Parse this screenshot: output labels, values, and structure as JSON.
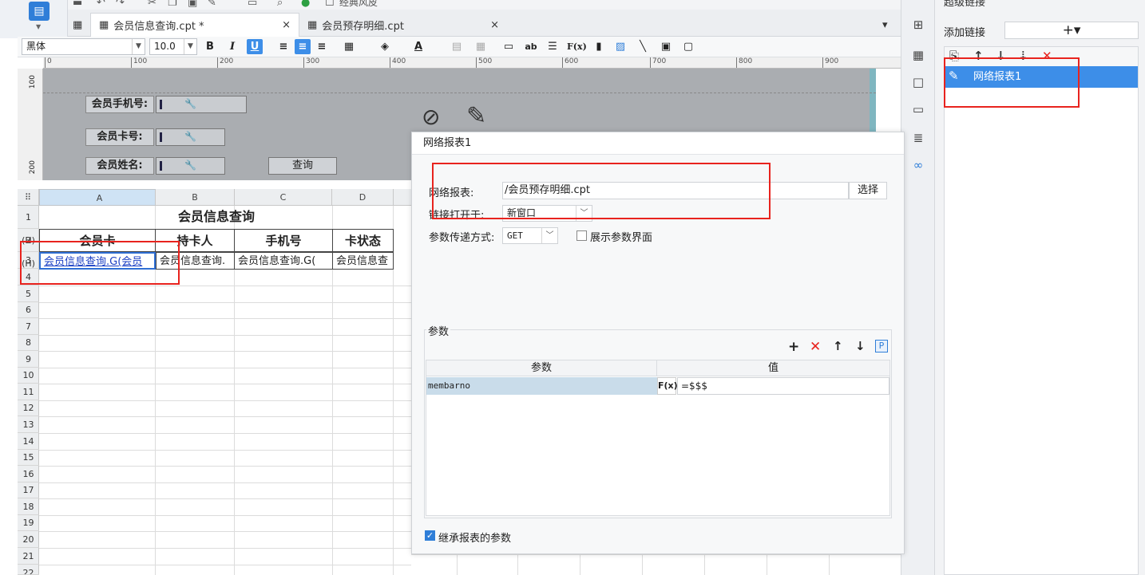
{
  "tabs": [
    {
      "label": "会员信息查询.cpt *",
      "close": "×"
    },
    {
      "label": "会员预存明细.cpt",
      "close": "×"
    }
  ],
  "toolbar": {
    "classic_label": "经典风皮",
    "font_family": "黑体",
    "font_size": "10.0"
  },
  "ruler": {
    "marks": [
      "0",
      "100",
      "200",
      "300",
      "400",
      "500",
      "600",
      "700",
      "800",
      "900"
    ]
  },
  "vruler": {
    "marks": [
      "100",
      "200"
    ]
  },
  "param_panel": {
    "labels": [
      "会员手机号:",
      "会员卡号:",
      "会员姓名:"
    ],
    "query_button": "查询"
  },
  "grid": {
    "columns": [
      "A",
      "B",
      "C",
      "D"
    ],
    "rows": [
      "1 (H)",
      "2 (H)",
      "3",
      "4",
      "5",
      "6",
      "7",
      "8",
      "9",
      "10",
      "11",
      "12",
      "13",
      "14",
      "15",
      "16",
      "17",
      "18",
      "19",
      "20",
      "21",
      "22"
    ],
    "title": "会员信息查询",
    "headers": [
      "会员卡",
      "持卡人",
      "手机号",
      "卡状态"
    ],
    "data_row": [
      "会员信息查询.G(会员",
      "会员信息查询.",
      "会员信息查询.G(",
      "会员信息查"
    ]
  },
  "sidebar": {
    "title": "超级链接",
    "add_link_label": "添加链接",
    "add_button": "+▾",
    "links": [
      "网络报表1"
    ]
  },
  "dialog": {
    "title": "网络报表1",
    "web_report_label": "网络报表:",
    "web_report_value": "/会员预存明细.cpt",
    "choose_button": "选择",
    "open_in_label": "链接打开于:",
    "open_in_value": "新窗口",
    "method_label": "参数传递方式:",
    "method_value": "GET",
    "show_param_label": "展示参数界面",
    "params_legend": "参数",
    "col_param": "参数",
    "col_value": "值",
    "param_name": "membarno",
    "param_value": "=$$$",
    "inherit_label": "继承报表的参数"
  }
}
